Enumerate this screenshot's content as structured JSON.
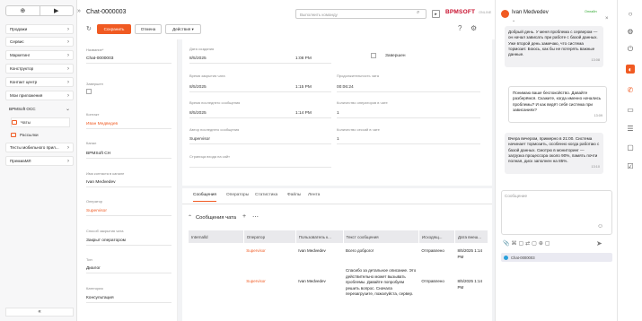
{
  "nav": {
    "items": [
      {
        "label": "Продажи"
      },
      {
        "label": "Сервис"
      },
      {
        "label": "Маркетинг"
      },
      {
        "label": "Конструктор"
      },
      {
        "label": "Контакт центр"
      },
      {
        "label": "Мои приложения"
      },
      {
        "label": "BPMSoft OCC"
      }
    ],
    "sub_items": [
      {
        "label": "Чаты"
      },
      {
        "label": "Рассылки"
      }
    ],
    "more_items": [
      {
        "label": "Тесты мобильного прил..."
      },
      {
        "label": "ПремиаМЛ"
      }
    ],
    "collapse_icon": "«"
  },
  "header": {
    "title": "Chat-0000003",
    "save_label": "Сохранить",
    "cancel_label": "Отмена",
    "actions_label": "Действия ▾",
    "search_placeholder": "Выполнить команду",
    "logo": "BPMSOFT",
    "logo_sub": "ONLINE"
  },
  "fields": [
    {
      "label": "Название*",
      "value": "Chat-0000003"
    },
    {
      "label": "Завершен",
      "value": ""
    },
    {
      "label": "Контакт",
      "value": "Иван Медведев",
      "link": true
    },
    {
      "label": "Канал",
      "value": "BPMSoft CH"
    },
    {
      "label": "Имя контакта в канале",
      "value": "Ivan Medvedev"
    },
    {
      "label": "Оператор",
      "value": "Supervisor",
      "link": true
    },
    {
      "label": "Способ закрытия чата",
      "value": "Закрыт оператором"
    },
    {
      "label": "Тип",
      "value": "Диалог"
    },
    {
      "label": "Категория",
      "value": "Консультация"
    }
  ],
  "info": {
    "created_label": "Дата создания",
    "created_date": "8/5/2025",
    "created_time": "1:08 PM",
    "finished_label": "Завершен",
    "closed_label": "Время закрытия чата",
    "closed_date": "8/5/2025",
    "closed_time": "1:15 PM",
    "duration_label": "Продолжительность чата",
    "duration_value": "00:06:24",
    "last_msg_label": "Время последнего сообщения",
    "last_msg_date": "8/5/2025",
    "last_msg_time": "1:14 PM",
    "operators_label": "Количество операторов в чате",
    "operators_value": "1",
    "last_author_label": "Автор последнего сообщения",
    "last_author_value": "Supervisor",
    "messages_label": "Количество сессий в чате",
    "messages_value": "1",
    "page_label": "Страница входа на сайт"
  },
  "tabs": [
    "Сообщения",
    "Операторы",
    "Статистика",
    "Файлы",
    "Лента"
  ],
  "messages_section": {
    "title": "Сообщения чата"
  },
  "table": {
    "headers": [
      "Internalld",
      "Оператор",
      "Пользователь к...",
      "Текст сообщения",
      "Исходящ...",
      "Дата внеш..."
    ],
    "rows": [
      [
        "",
        "Supervisor",
        "Ivan Medvedev",
        "Всего доброго!",
        "Отправлено",
        "8/5/2025 1:14 PM"
      ],
      [
        "",
        "Supervisor",
        "Ivan Medvedev",
        "Спасибо за детальное описание. Это действительно может вызывать проблемы. Давайте попробуем решить вопрос. Сначала перезагрузите, пожалуйста, сервер. Это часто помогает",
        "Отправлено",
        "8/5/2025 1:14 PM"
      ]
    ]
  },
  "chat": {
    "name": "Ivan Medvedev",
    "status": "Онлайн",
    "chat_id": "Chat-0000003",
    "messages": [
      {
        "text": "Добрый день. У меня проблема с сервером — он начал зависать при работе с базой данных. Уже второй день замечаю, что система тормозит. Боюсь, как бы не потерять важные данные.",
        "time": "13:08"
      },
      {
        "text": "Понимаю ваше беспокойство. Давайте разберёмся. Скажите, когда именно начались проблемы? И как ведёт себя система при зависаниях?",
        "time": "13:09"
      },
      {
        "text": "Вчера вечером, примерно в 21:00. Система начинает тормозить, особенно когда работаю с базой данных. Смотрю в мониторинг — загрузка процессора около 90%, память почти полная, диск заполнен на 85%.",
        "time": "13:10"
      }
    ],
    "input_placeholder": "Сообщение"
  },
  "colors": {
    "accent": "#f05a22",
    "brand": "#c8102e"
  }
}
